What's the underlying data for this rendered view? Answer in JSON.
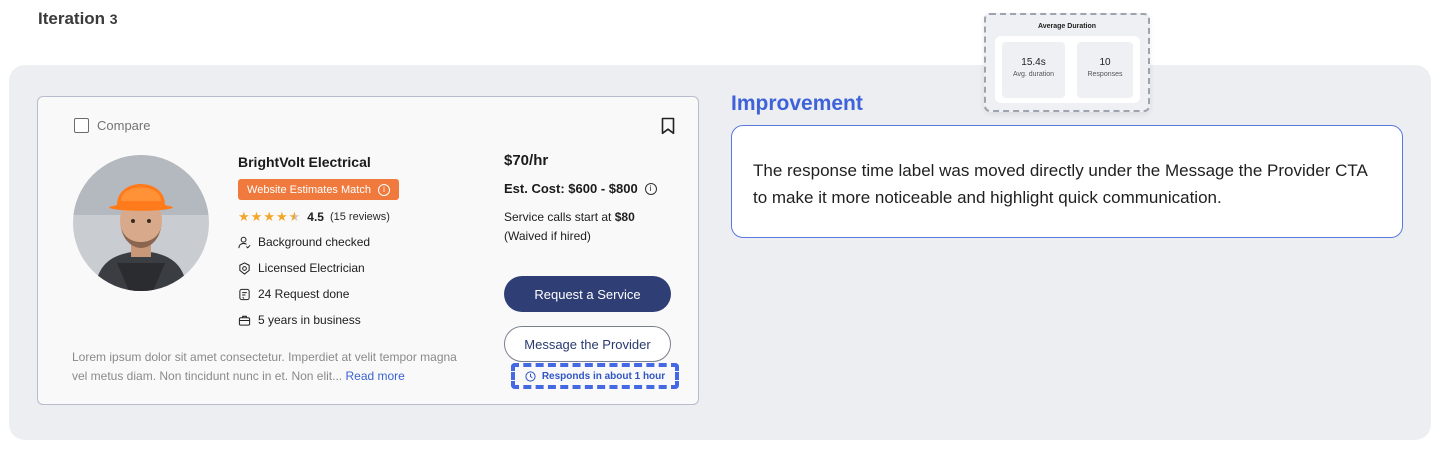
{
  "page": {
    "iteration_label": "Iteration",
    "iteration_number": "3"
  },
  "card": {
    "compare_label": "Compare",
    "provider_name": "BrightVolt Electrical",
    "badge_label": "Website Estimates Match",
    "rating": {
      "stars": 4.5,
      "score": "4.5",
      "reviews": "(15 reviews)"
    },
    "features": [
      {
        "icon": "user-check-icon",
        "label": "Background checked"
      },
      {
        "icon": "shield-badge-icon",
        "label": "Licensed Electrician"
      },
      {
        "icon": "request-list-icon",
        "label": "24 Request done"
      },
      {
        "icon": "briefcase-icon",
        "label": "5 years in business"
      }
    ],
    "description": "Lorem ipsum dolor sit amet consectetur. Imperdiet at velit tempor magna vel metus diam. Non tincidunt nunc in et. Non elit...",
    "read_more": "Read more",
    "price": "$70/hr",
    "est_cost": "Est. Cost: $600 - $800",
    "service_calls_prefix": "Service calls start at",
    "service_calls_amount": "$80",
    "service_calls_note": "(Waived if hired)",
    "request_button": "Request a Service",
    "message_button": "Message the Provider",
    "responds_label": "Responds in about 1 hour"
  },
  "improvement": {
    "title": "Improvement",
    "text": "The response time label was moved directly under the Message the Provider CTA to make it more noticeable and highlight quick communication."
  },
  "avg_duration": {
    "title": "Average Duration",
    "stats": [
      {
        "value": "15.4s",
        "label": "Avg. duration"
      },
      {
        "value": "10",
        "label": "Responses"
      }
    ]
  },
  "colors": {
    "badge": "#f07a3d",
    "primary_button": "#2f3e74",
    "accent_blue": "#3e63d8",
    "star": "#f4a62a"
  }
}
